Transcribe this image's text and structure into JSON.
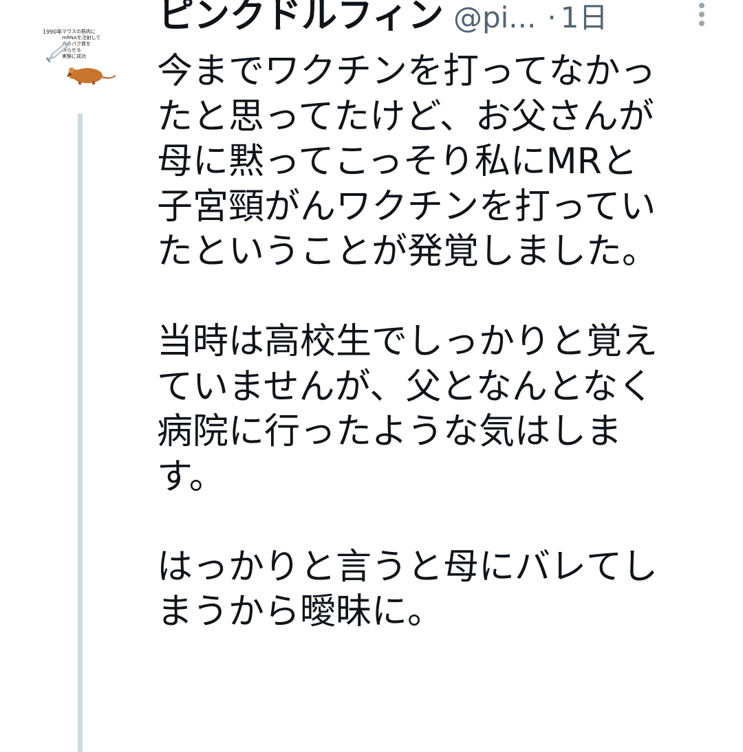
{
  "colors": {
    "text_primary": "#0f1419",
    "text_secondary": "#536471",
    "thread_line": "#cfd9de"
  },
  "avatar": {
    "icon": "mouse-syringe-avatar",
    "year": "1990年",
    "caption": "マウスの筋肉に\nmRNAを注射して\nタンパク質を\n作らせる\n実験に成功"
  },
  "header": {
    "display_name": "ピンクドルフィン",
    "handle": "@pi...",
    "separator": "·",
    "time": "1日",
    "more_icon": "more-vertical-icon"
  },
  "tweet": {
    "paragraphs": [
      {
        "lines": [
          "今までワクチンを打ってなかっ",
          "たと思ってたけど、お父さんが",
          "母に黙ってこっそり私にMRと",
          "子宮頸がんワクチンを打ってい",
          "たということが発覚しました。"
        ]
      },
      {
        "lines": [
          "当時は高校生でしっかりと覚え",
          "ていませんが、父となんとなく",
          "病院に行ったような気はしま",
          "す。"
        ]
      },
      {
        "lines": [
          "はっかりと言うと母にバレてし",
          "まうから曖昧に。"
        ]
      }
    ]
  }
}
